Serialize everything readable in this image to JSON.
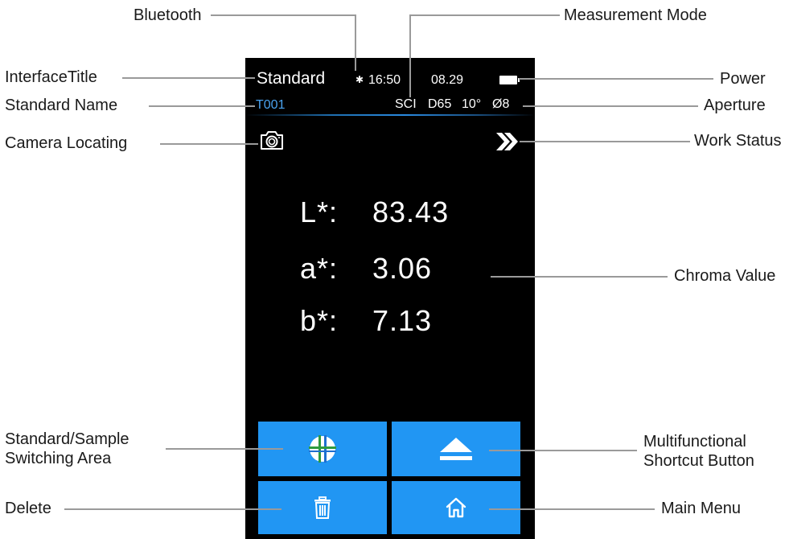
{
  "annotations": {
    "bluetooth": "Bluetooth",
    "measurement_mode": "Measurement Mode",
    "interface_title": "InterfaceTitle",
    "power": "Power",
    "standard_name": "Standard Name",
    "aperture": "Aperture",
    "camera_locating": "Camera Locating",
    "work_status": "Work Status",
    "chroma_value": "Chroma Value",
    "switching_area_line1": "Standard/Sample",
    "switching_area_line2": "Switching Area",
    "shortcut_line1": "Multifunctional",
    "shortcut_line2": "Shortcut Button",
    "delete": "Delete",
    "main_menu": "Main Menu"
  },
  "screen": {
    "title": "Standard",
    "bluetooth_glyph": "✱",
    "time": "16:50",
    "date": "08.29",
    "standard_name": "T001",
    "mode": "SCI",
    "illuminant": "D65",
    "observer": "10°",
    "aperture": "Ø8",
    "values": {
      "l_label": "L*:",
      "l_value": "83.43",
      "a_label": "a*:",
      "a_value": "3.06",
      "b_label": "b*:",
      "b_value": "7.13"
    }
  },
  "colors": {
    "tile_blue": "#2196f3",
    "standard_name_blue": "#4aa3f0",
    "icon_green": "#2e9b3f"
  },
  "icons": {
    "camera": "camera-icon",
    "work_status": "double-chevron-right-icon",
    "switch": "crosshair-circle-icon",
    "shortcut": "eject-icon",
    "delete": "trash-icon",
    "home": "home-icon",
    "battery": "battery-icon"
  }
}
